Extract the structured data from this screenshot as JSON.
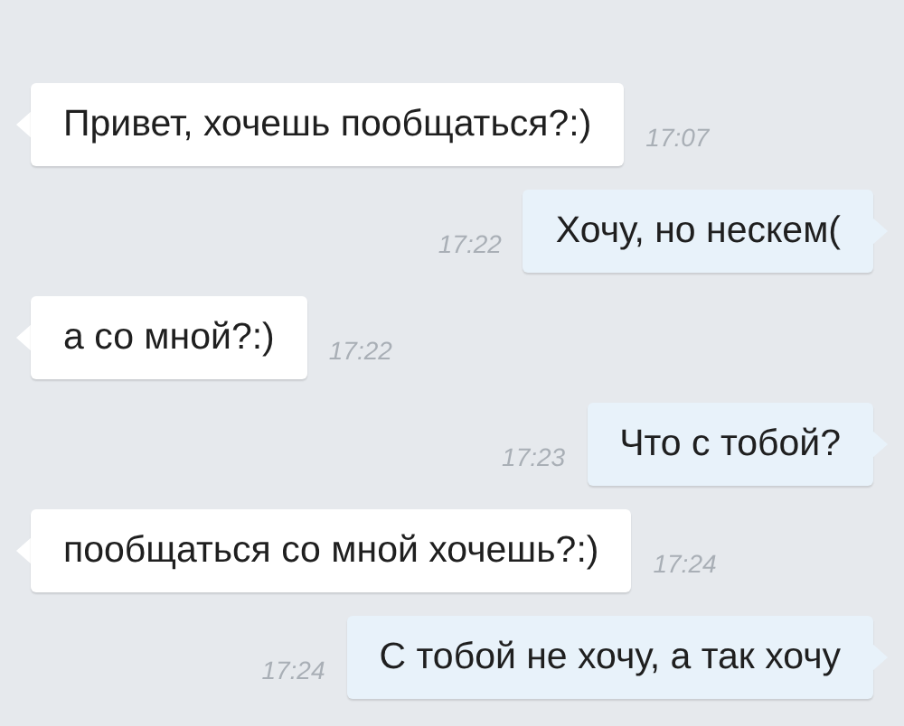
{
  "messages": [
    {
      "kind": "incoming",
      "text": "Привет, хочешь пообщаться?:)",
      "time": "17:07"
    },
    {
      "kind": "outgoing",
      "text": "Хочу, но нескем(",
      "time": "17:22"
    },
    {
      "kind": "incoming",
      "text": "а со мной?:)",
      "time": "17:22"
    },
    {
      "kind": "outgoing",
      "text": "Что с тобой?",
      "time": "17:23"
    },
    {
      "kind": "incoming",
      "text": "пообщаться со мной хочешь?:)",
      "time": "17:24"
    },
    {
      "kind": "outgoing",
      "text": "С тобой не хочу, а так хочу",
      "time": "17:24"
    }
  ]
}
